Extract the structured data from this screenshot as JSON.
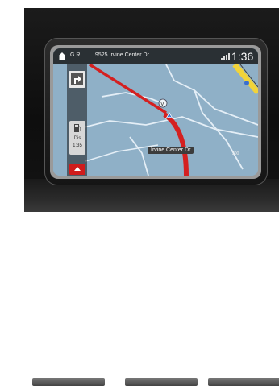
{
  "header": {
    "road_code": "G R",
    "street": "9525 Irvine Center Dr",
    "time": "1:36"
  },
  "map": {
    "current_street": "Irvine Center Dr",
    "scale": "200"
  },
  "side_panel": {
    "info_line1": "Dis",
    "info_line2": "1:35"
  },
  "colors": {
    "route": "#d42020",
    "map_background": "#8fb0c7",
    "road": "#e4eef6",
    "highway": "#f1d33a",
    "menu_button": "#d01c1c"
  },
  "icons": [
    "home-icon",
    "turn-right-icon",
    "fuel-pump-icon",
    "menu-icon",
    "signal-icon",
    "vehicle-position-icon"
  ]
}
